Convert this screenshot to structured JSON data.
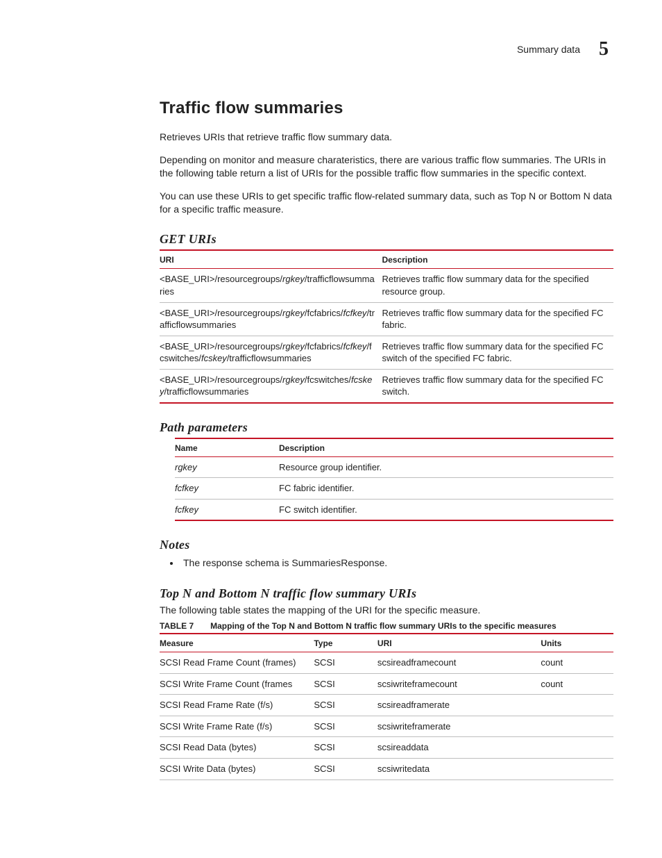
{
  "header": {
    "section": "Summary data",
    "chapter_number": "5"
  },
  "title": "Traffic flow summaries",
  "intro": [
    "Retrieves URIs that retrieve traffic flow summary data.",
    "Depending on monitor and measure charateristics, there are various traffic flow summaries. The URIs in the following table return a list of URIs for the possible traffic flow summaries in the specific context.",
    "You can use these URIs to get specific traffic flow-related summary data, such as Top N or Bottom N data for a specific traffic measure."
  ],
  "sections": {
    "get_uris": {
      "heading": "GET URIs",
      "cols": [
        "URI",
        "Description"
      ],
      "rows": [
        {
          "uri_parts": [
            "<BASE_URI>/resourcegroups/",
            {
              "i": "rgkey"
            },
            "/trafficflowsummaries"
          ],
          "desc": "Retrieves traffic flow summary data for the specified resource group."
        },
        {
          "uri_parts": [
            "<BASE_URI>/resourcegroups/",
            {
              "i": "rgkey"
            },
            "/fcfabrics/",
            {
              "i": "fcfkey"
            },
            "/trafficflowsummaries"
          ],
          "desc": "Retrieves traffic flow summary data for the specified FC fabric."
        },
        {
          "uri_parts": [
            "<BASE_URI>/resourcegroups/",
            {
              "i": "rgkey"
            },
            "/fcfabrics/",
            {
              "i": "fcfkey"
            },
            "/fcswitches/",
            {
              "i": "fcskey"
            },
            "/trafficflowsummaries"
          ],
          "desc": "Retrieves traffic flow summary data for the specified FC switch of the specified FC fabric."
        },
        {
          "uri_parts": [
            "<BASE_URI>/resourcegroups/",
            {
              "i": "rgkey"
            },
            "/fcswitches/",
            {
              "i": "fcskey"
            },
            "/trafficflowsummaries"
          ],
          "desc": "Retrieves traffic flow summary data for the specified FC switch."
        }
      ]
    },
    "path_params": {
      "heading": "Path parameters",
      "cols": [
        "Name",
        "Description"
      ],
      "rows": [
        {
          "name": "rgkey",
          "desc": "Resource group identifier."
        },
        {
          "name": "fcfkey",
          "desc": "FC fabric identifier."
        },
        {
          "name": "fcfkey",
          "desc": "FC switch identifier."
        }
      ]
    },
    "notes": {
      "heading": "Notes",
      "items": [
        "The response schema is SummariesResponse."
      ]
    },
    "topn": {
      "heading": "Top N and Bottom N traffic flow summary URIs",
      "intro": "The following table states the mapping of the URI for the specific measure.",
      "table_label": "TABLE 7",
      "table_caption": "Mapping of the Top N and Bottom N traffic flow summary URIs to the specific measures",
      "cols": [
        "Measure",
        "Type",
        "URI",
        "Units"
      ],
      "rows": [
        {
          "measure": "SCSI Read Frame Count (frames)",
          "type": "SCSI",
          "uri": "scsireadframecount",
          "units": "count"
        },
        {
          "measure": "SCSI Write Frame Count (frames",
          "type": "SCSI",
          "uri": "scsiwriteframecount",
          "units": "count"
        },
        {
          "measure": "SCSI Read Frame Rate (f/s)",
          "type": "SCSI",
          "uri": "scsireadframerate",
          "units": ""
        },
        {
          "measure": "SCSI Write Frame Rate (f/s)",
          "type": "SCSI",
          "uri": "scsiwriteframerate",
          "units": ""
        },
        {
          "measure": "SCSI Read Data (bytes)",
          "type": "SCSI",
          "uri": "scsireaddata",
          "units": ""
        },
        {
          "measure": "SCSI Write Data (bytes)",
          "type": "SCSI",
          "uri": "scsiwritedata",
          "units": ""
        }
      ]
    }
  }
}
